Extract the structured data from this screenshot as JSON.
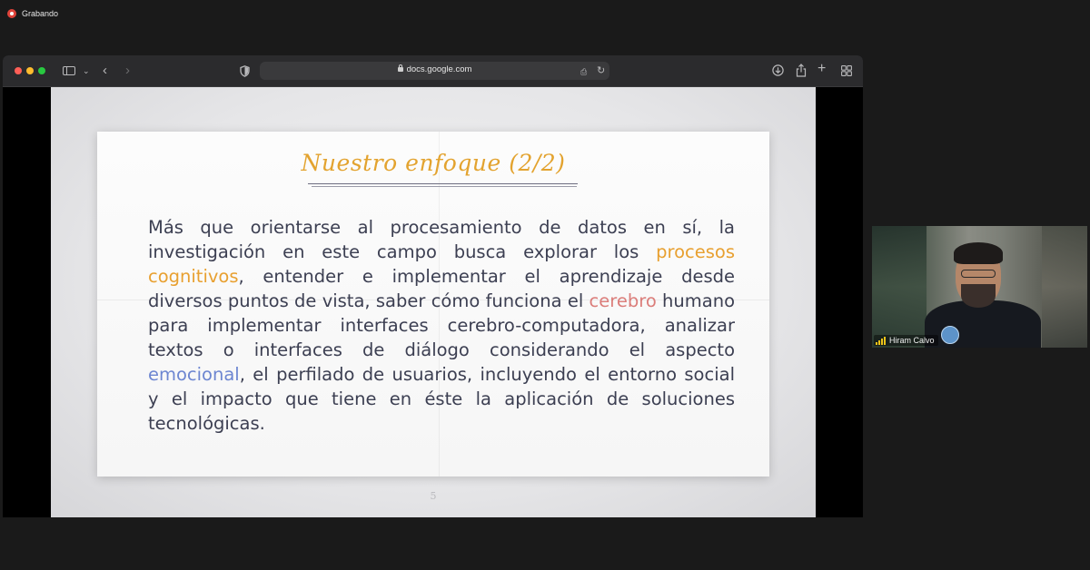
{
  "recording": {
    "label": "Grabando"
  },
  "browser": {
    "url": "docs.google.com"
  },
  "slide": {
    "title": "Nuestro enfoque (2/2)",
    "body": {
      "t1": "Más que orientarse al procesamiento de datos en sí, la investigación en este campo busca explorar los ",
      "h1": "procesos cognitivos",
      "t2": ", entender e implementar el aprendizaje desde diversos puntos de vista, saber cómo funciona el ",
      "h2": "cerebro",
      "t3": " humano para implementar interfaces cerebro-computadora, analizar textos o interfaces de diálogo considerando el aspecto ",
      "h3": "emocional",
      "t4": ", el perfilado de usuarios, incluyendo el entorno social y el impacto que tiene en éste la aplicación de soluciones tecnológicas."
    },
    "page_number": "5",
    "colors": {
      "title": "#e3a32f",
      "orange": "#e8a030",
      "red": "#db7d7a",
      "blue": "#6d86d1",
      "text": "#3c3f52"
    }
  },
  "participant": {
    "name": "Hiram Calvo",
    "icons": {
      "signal": "signal-bars-icon"
    }
  },
  "toolbar_icons": [
    "sidebar-icon",
    "chevron-down-icon",
    "back-icon",
    "forward-icon",
    "shield-icon",
    "lock-icon",
    "translate-icon",
    "reload-icon",
    "download-icon",
    "share-icon",
    "new-tab-icon",
    "tab-overview-icon"
  ]
}
